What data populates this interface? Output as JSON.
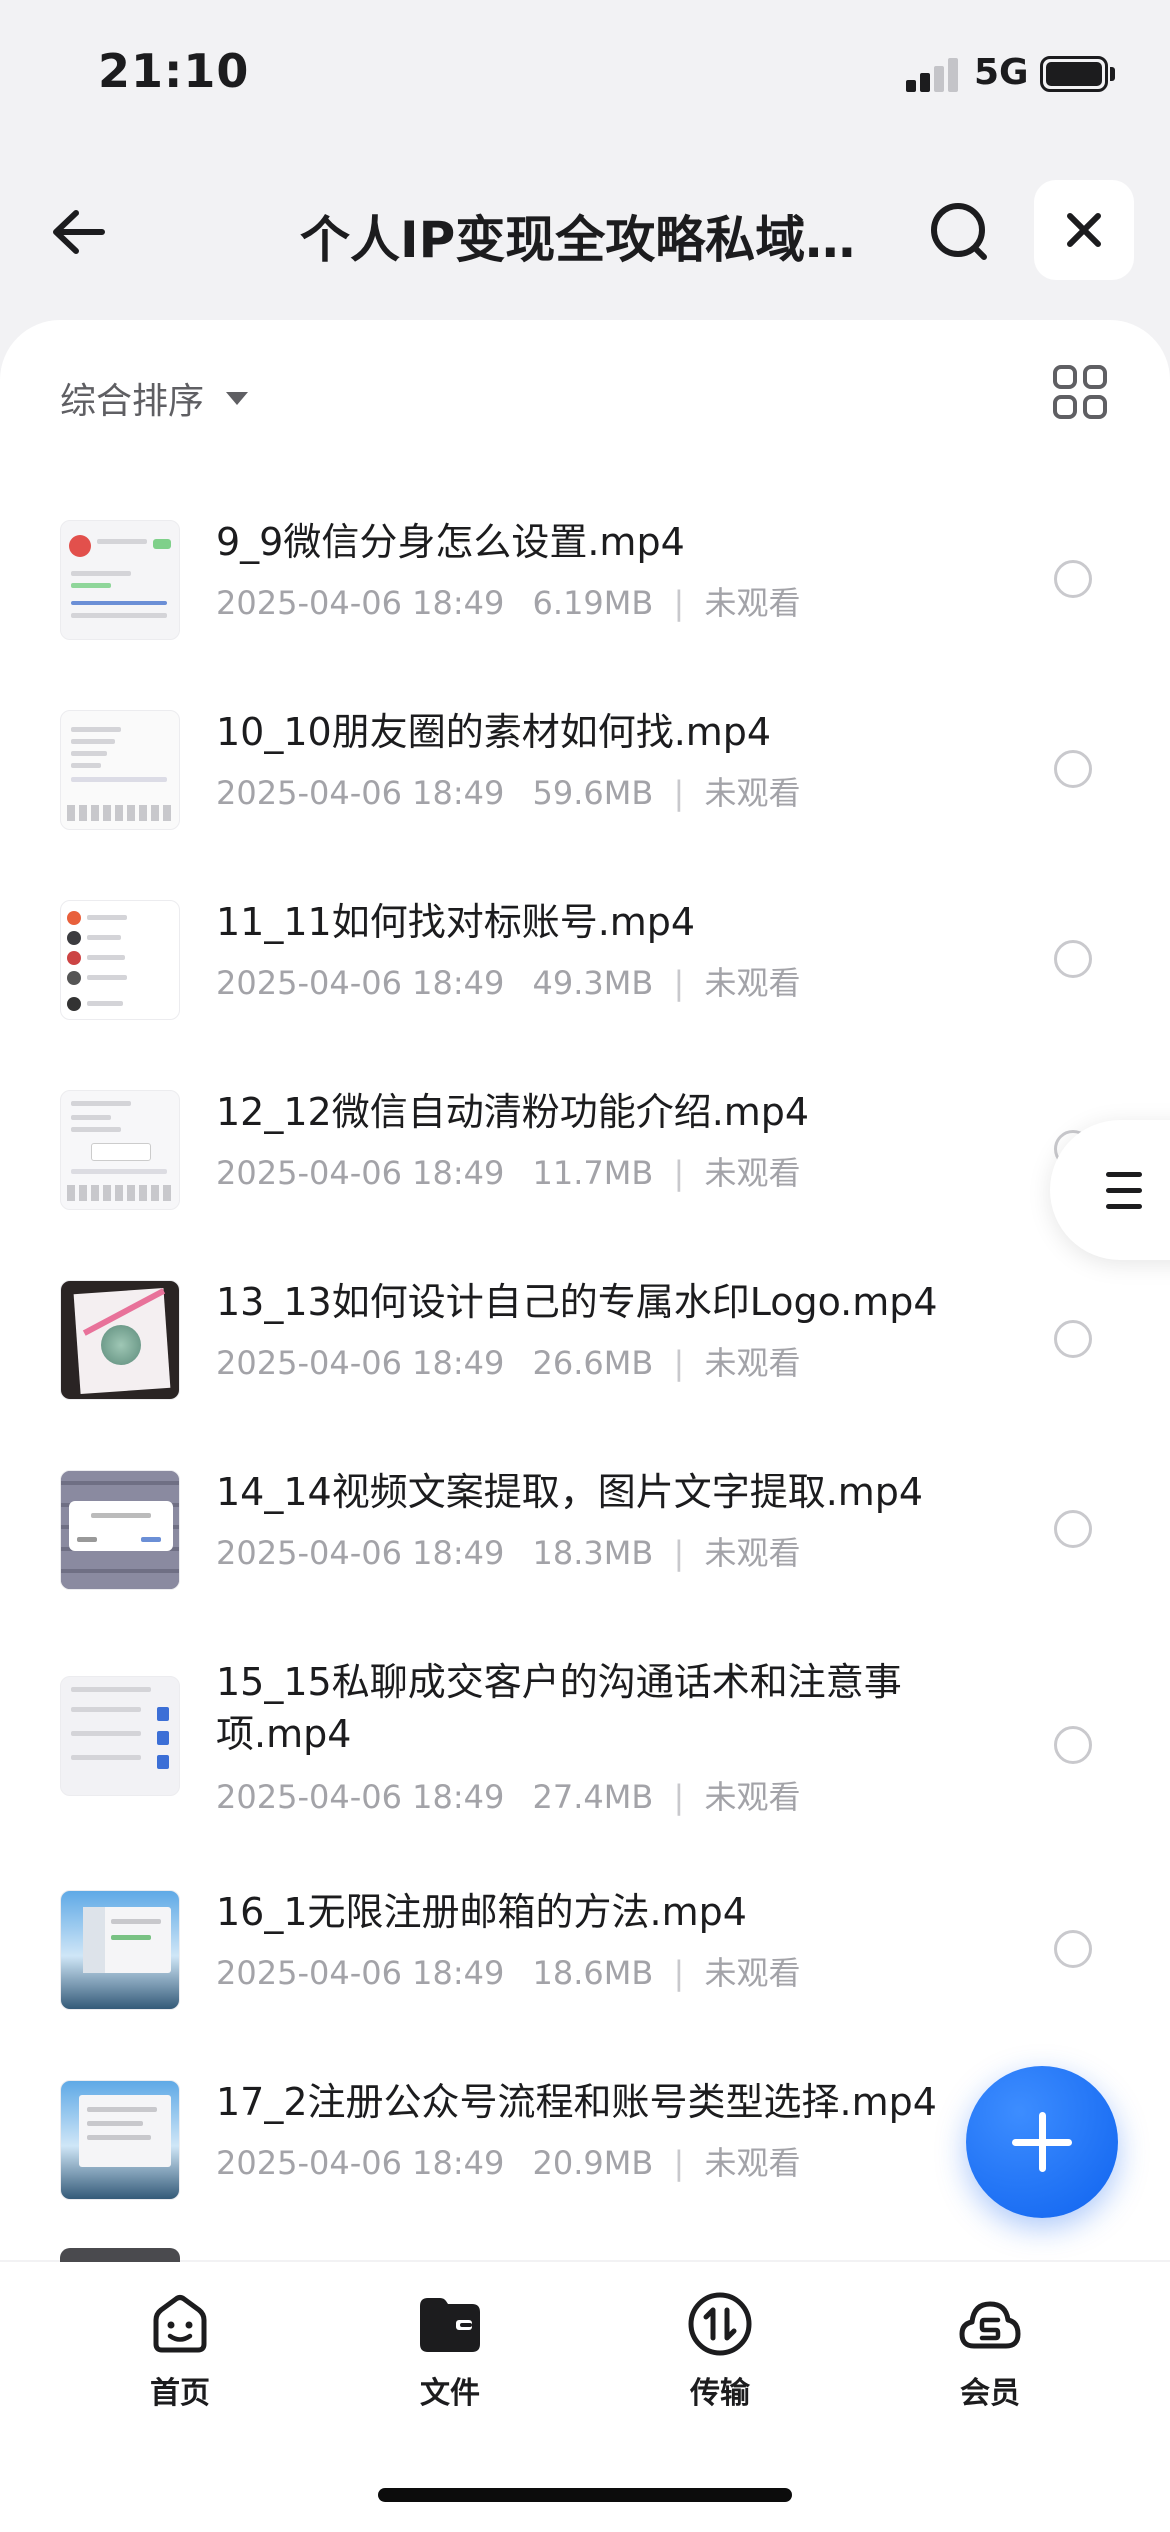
{
  "status_bar": {
    "time": "21:10",
    "network": "5G"
  },
  "header": {
    "title": "个人IP变现全攻略私域..."
  },
  "sort": {
    "label": "综合排序"
  },
  "files": [
    {
      "name": "9_9微信分身怎么设置.mp4",
      "date": "2025-04-06 18:49",
      "size": "6.19MB",
      "status": "未观看",
      "thumb": "wechat-screenshot"
    },
    {
      "name": "10_10朋友圈的素材如何找.mp4",
      "date": "2025-04-06 18:49",
      "size": "59.6MB",
      "status": "未观看",
      "thumb": "text-keyboard"
    },
    {
      "name": "11_11如何找对标账号.mp4",
      "date": "2025-04-06 18:49",
      "size": "49.3MB",
      "status": "未观看",
      "thumb": "contact-list"
    },
    {
      "name": "12_12微信自动清粉功能介绍.mp4",
      "date": "2025-04-06 18:49",
      "size": "11.7MB",
      "status": "未观看",
      "thumb": "settings-keyboard"
    },
    {
      "name": "13_13如何设计自己的专属水印Logo.mp4",
      "date": "2025-04-06 18:49",
      "size": "26.6MB",
      "status": "未观看",
      "thumb": "watermark-photo"
    },
    {
      "name": "14_14视频文案提取，图片文字提取.mp4",
      "date": "2025-04-06 18:49",
      "size": "18.3MB",
      "status": "未观看",
      "thumb": "dialog-screenshot"
    },
    {
      "name": "15_15私聊成交客户的沟通话术和注意事项.mp4",
      "date": "2025-04-06 18:49",
      "size": "27.4MB",
      "status": "未观看",
      "thumb": "chat-screenshot"
    },
    {
      "name": "16_1无限注册邮箱的方法.mp4",
      "date": "2025-04-06 18:49",
      "size": "18.6MB",
      "status": "未观看",
      "thumb": "desktop-screenshot"
    },
    {
      "name": "17_2注册公众号流程和账号类型选择.mp4",
      "date": "2025-04-06 18:49",
      "size": "20.9MB",
      "status": "未观看",
      "thumb": "desktop-screenshot"
    }
  ],
  "nav": [
    {
      "label": "首页",
      "icon": "home-face-icon"
    },
    {
      "label": "文件",
      "icon": "folder-icon"
    },
    {
      "label": "传输",
      "icon": "transfer-icon"
    },
    {
      "label": "会员",
      "icon": "vip-cloud-icon"
    }
  ],
  "colors": {
    "accent": "#0f63ef",
    "text_primary": "#1c1c1e",
    "text_secondary": "#a3a3a8",
    "background": "#f2f2f4"
  }
}
